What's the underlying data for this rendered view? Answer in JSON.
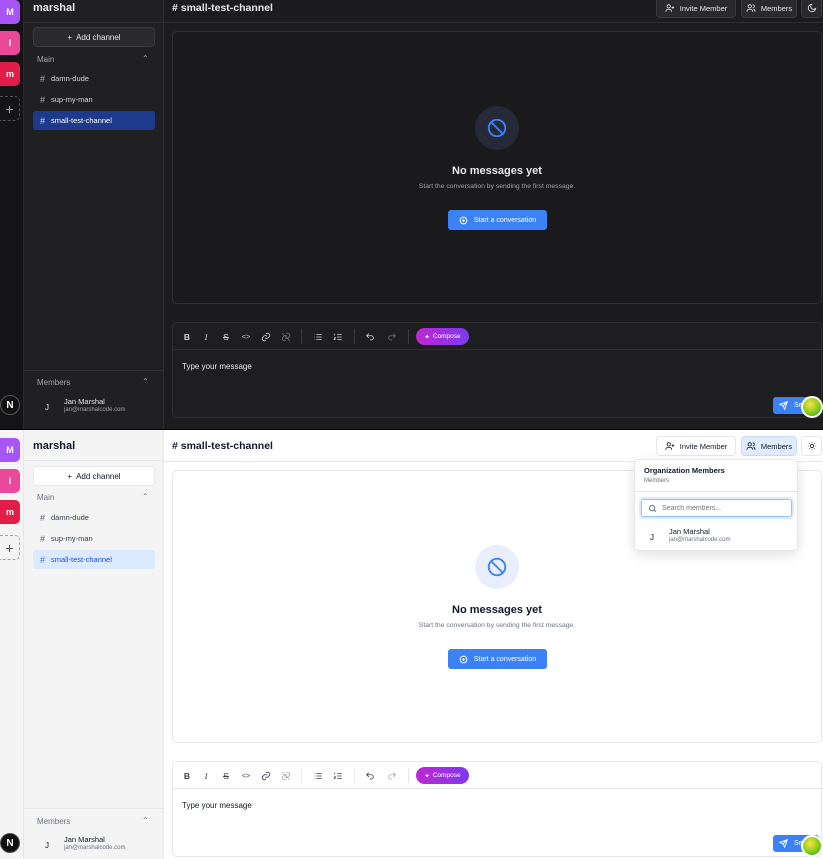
{
  "orgs": [
    {
      "letter": "M",
      "color": "#a855f7"
    },
    {
      "letter": "I",
      "color": "#ec4899"
    },
    {
      "letter": "m",
      "color": "#e11d48"
    }
  ],
  "org_add_label": "+",
  "n_badge": "N",
  "workspace": {
    "name": "marshal"
  },
  "sidebar": {
    "add_channel": "Add channel",
    "section_label": "Main",
    "channels": [
      "damn-dude",
      "sup-my-man",
      "small-test-channel"
    ],
    "members_label": "Members"
  },
  "member": {
    "initial": "J",
    "name": "Jan Marshal",
    "email": "jan@marshalcode.com"
  },
  "header": {
    "channel_title": "# small-test-channel",
    "invite_label": "Invite Member",
    "members_label": "Members"
  },
  "empty": {
    "title": "No messages yet",
    "subtitle": "Start the conversation by sending the first message.",
    "button": "Start a conversation"
  },
  "composer": {
    "bold": "B",
    "italic": "I",
    "strike": "S",
    "code": "<>",
    "compose_label": "Compose",
    "placeholder": "Type your message",
    "send_label": "Send"
  },
  "popover": {
    "title": "Organization Members",
    "subtitle": "Members",
    "search_placeholder": "Search members..."
  },
  "colors": {
    "accent": "#3b82f6",
    "compose_gradient_start": "#c026d3",
    "compose_gradient_end": "#7c3aed"
  }
}
